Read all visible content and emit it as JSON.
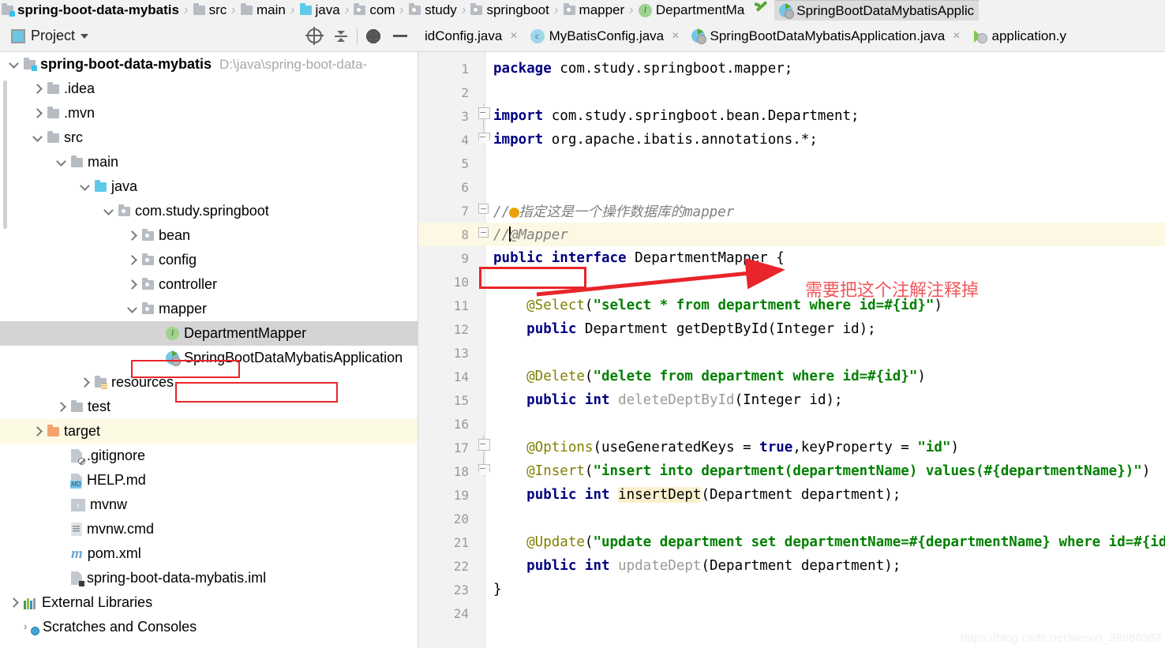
{
  "breadcrumb": {
    "items": [
      {
        "label": "spring-boot-data-mybatis",
        "icon": "module-folder-icon",
        "kind": "module"
      },
      {
        "label": "src",
        "icon": "folder-icon",
        "kind": "folder"
      },
      {
        "label": "main",
        "icon": "folder-icon",
        "kind": "folder"
      },
      {
        "label": "java",
        "icon": "source-folder-icon",
        "kind": "source"
      },
      {
        "label": "com",
        "icon": "package-icon",
        "kind": "package"
      },
      {
        "label": "study",
        "icon": "package-icon",
        "kind": "package"
      },
      {
        "label": "springboot",
        "icon": "package-icon",
        "kind": "package"
      },
      {
        "label": "mapper",
        "icon": "package-icon",
        "kind": "package"
      },
      {
        "label": "DepartmentMa",
        "icon": "interface-icon",
        "kind": "interface"
      }
    ],
    "separator": "›",
    "running_tab": {
      "label": "SpringBootDataMybatisApplic",
      "icon": "spring-boot-run-icon"
    },
    "green_arrow_icon": "green-arrow-icon"
  },
  "toolwindow": {
    "title": "Project",
    "project_icon": "project-icon",
    "dropdown_icon": "chevron-down-icon",
    "actions": [
      {
        "name": "locate-icon",
        "title": "Select Opened File"
      },
      {
        "name": "collapse-all-icon",
        "title": "Collapse All"
      },
      {
        "name": "gear-icon",
        "title": "Settings"
      },
      {
        "name": "minimize-icon",
        "title": "Hide"
      }
    ]
  },
  "editor_tabs": [
    {
      "label": "idConfig.java",
      "icon": "java-class-icon",
      "active": false,
      "closable": true,
      "clipped": true
    },
    {
      "label": "MyBatisConfig.java",
      "icon": "java-class-icon",
      "active": false,
      "closable": true
    },
    {
      "label": "SpringBootDataMybatisApplication.java",
      "icon": "spring-boot-class-icon",
      "active": false,
      "closable": true
    },
    {
      "label": "application.y",
      "icon": "yaml-file-icon",
      "active": false,
      "closable": false,
      "clipped": true
    }
  ],
  "tree": {
    "rows": [
      {
        "indent": 0,
        "twist": "down",
        "icon": "module-folder-icon",
        "label": "spring-boot-data-mybatis",
        "bold": true,
        "path": "D:\\java\\spring-boot-data-"
      },
      {
        "indent": 1,
        "twist": "right",
        "icon": "folder-icon",
        "label": ".idea"
      },
      {
        "indent": 1,
        "twist": "right",
        "icon": "folder-icon",
        "label": ".mvn"
      },
      {
        "indent": 1,
        "twist": "down",
        "icon": "folder-icon",
        "label": "src"
      },
      {
        "indent": 2,
        "twist": "down",
        "icon": "folder-icon",
        "label": "main"
      },
      {
        "indent": 3,
        "twist": "down",
        "icon": "source-folder-icon",
        "label": "java"
      },
      {
        "indent": 4,
        "twist": "down",
        "icon": "package-icon",
        "label": "com.study.springboot"
      },
      {
        "indent": 5,
        "twist": "right",
        "icon": "package-icon",
        "label": "bean"
      },
      {
        "indent": 5,
        "twist": "right",
        "icon": "package-icon",
        "label": "config"
      },
      {
        "indent": 5,
        "twist": "right",
        "icon": "package-icon",
        "label": "controller"
      },
      {
        "indent": 5,
        "twist": "down",
        "icon": "package-icon",
        "label": "mapper",
        "boxed": true
      },
      {
        "indent": 6,
        "twist": "none",
        "icon": "interface-icon",
        "label": "DepartmentMapper",
        "selected": true,
        "boxed": true
      },
      {
        "indent": 6,
        "twist": "none",
        "icon": "spring-boot-class-icon",
        "label": "SpringBootDataMybatisApplication"
      },
      {
        "indent": 3,
        "twist": "right",
        "icon": "resources-folder-icon",
        "label": "resources"
      },
      {
        "indent": 2,
        "twist": "right",
        "icon": "folder-icon",
        "label": "test"
      },
      {
        "indent": 1,
        "twist": "right",
        "icon": "target-folder-icon",
        "label": "target",
        "highlight": true
      },
      {
        "indent": 2,
        "twist": "none",
        "icon": "gitignore-file-icon",
        "label": ".gitignore"
      },
      {
        "indent": 2,
        "twist": "none",
        "icon": "markdown-file-icon",
        "label": "HELP.md"
      },
      {
        "indent": 2,
        "twist": "none",
        "icon": "shell-script-icon",
        "label": "mvnw"
      },
      {
        "indent": 2,
        "twist": "none",
        "icon": "cmd-script-icon",
        "label": "mvnw.cmd"
      },
      {
        "indent": 2,
        "twist": "none",
        "icon": "maven-file-icon",
        "label": "pom.xml"
      },
      {
        "indent": 2,
        "twist": "none",
        "icon": "iml-file-icon",
        "label": "spring-boot-data-mybatis.iml"
      },
      {
        "indent": 0,
        "twist": "right",
        "icon": "external-libraries-icon",
        "label": "External Libraries"
      },
      {
        "indent": 0,
        "twist": "none",
        "icon": "scratches-icon",
        "label": "Scratches and Consoles"
      }
    ]
  },
  "code": {
    "lines": [
      {
        "n": "1",
        "fold": "none",
        "segments": [
          {
            "t": "package ",
            "c": "kw"
          },
          {
            "t": "com.study.springboot.mapper;",
            "c": ""
          }
        ]
      },
      {
        "n": "2",
        "fold": "none",
        "segments": []
      },
      {
        "n": "3",
        "fold": "top",
        "segments": [
          {
            "t": "import ",
            "c": "kw"
          },
          {
            "t": "com.study.springboot.bean.Department;",
            "c": ""
          }
        ]
      },
      {
        "n": "4",
        "fold": "end",
        "segments": [
          {
            "t": "import ",
            "c": "kw"
          },
          {
            "t": "org.apache.ibatis.annotations.*;",
            "c": ""
          }
        ]
      },
      {
        "n": "5",
        "fold": "none",
        "segments": []
      },
      {
        "n": "6",
        "fold": "none",
        "segments": []
      },
      {
        "n": "7",
        "fold": "minus",
        "segments": [
          {
            "t": "//",
            "c": "cmt"
          },
          {
            "t": "",
            "c": "warn-dot"
          },
          {
            "t": "指定这是一个操作数据库的mapper",
            "c": "cmt"
          }
        ]
      },
      {
        "n": "8",
        "fold": "minus",
        "hl": true,
        "boxed": true,
        "segments": [
          {
            "t": "//",
            "c": "cmt"
          },
          {
            "t": "",
            "c": "caret"
          },
          {
            "t": "@Mapper",
            "c": "cmt"
          }
        ]
      },
      {
        "n": "9",
        "fold": "none",
        "segments": [
          {
            "t": "public ",
            "c": "kw"
          },
          {
            "t": "interface ",
            "c": "kw"
          },
          {
            "t": "DepartmentMapper {",
            "c": ""
          }
        ]
      },
      {
        "n": "10",
        "fold": "none",
        "segments": []
      },
      {
        "n": "11",
        "fold": "none",
        "segments": [
          {
            "t": "    @Select",
            "c": "ann"
          },
          {
            "t": "(",
            "c": ""
          },
          {
            "t": "\"select * from department where id=#{id}\"",
            "c": "str"
          },
          {
            "t": ")",
            "c": ""
          }
        ]
      },
      {
        "n": "12",
        "fold": "none",
        "segments": [
          {
            "t": "    ",
            "c": ""
          },
          {
            "t": "public ",
            "c": "kw"
          },
          {
            "t": "Department getDeptById(Integer id);",
            "c": ""
          }
        ]
      },
      {
        "n": "13",
        "fold": "none",
        "segments": []
      },
      {
        "n": "14",
        "fold": "none",
        "segments": [
          {
            "t": "    @Delete",
            "c": "ann"
          },
          {
            "t": "(",
            "c": ""
          },
          {
            "t": "\"delete from department where id=#{id}\"",
            "c": "str"
          },
          {
            "t": ")",
            "c": ""
          }
        ]
      },
      {
        "n": "15",
        "fold": "none",
        "segments": [
          {
            "t": "    ",
            "c": ""
          },
          {
            "t": "public ",
            "c": "kw"
          },
          {
            "t": "int ",
            "c": "kw"
          },
          {
            "t": "deleteDeptById",
            "c": "meth"
          },
          {
            "t": "(Integer id);",
            "c": ""
          }
        ]
      },
      {
        "n": "16",
        "fold": "none",
        "segments": []
      },
      {
        "n": "17",
        "fold": "top",
        "segments": [
          {
            "t": "    @Options",
            "c": "ann"
          },
          {
            "t": "(useGeneratedKeys = ",
            "c": ""
          },
          {
            "t": "true",
            "c": "kw"
          },
          {
            "t": ",keyProperty = ",
            "c": ""
          },
          {
            "t": "\"id\"",
            "c": "str"
          },
          {
            "t": ")",
            "c": ""
          }
        ]
      },
      {
        "n": "18",
        "fold": "end",
        "segments": [
          {
            "t": "    @Insert",
            "c": "ann"
          },
          {
            "t": "(",
            "c": ""
          },
          {
            "t": "\"insert into department(departmentName) values(#{departmentName})\"",
            "c": "str"
          },
          {
            "t": ")",
            "c": ""
          }
        ]
      },
      {
        "n": "19",
        "fold": "none",
        "segments": [
          {
            "t": "    ",
            "c": ""
          },
          {
            "t": "public ",
            "c": "kw"
          },
          {
            "t": "int ",
            "c": "kw"
          },
          {
            "t": "insertDept",
            "c": "hl-yellow-txt"
          },
          {
            "t": "(Department department);",
            "c": ""
          }
        ]
      },
      {
        "n": "20",
        "fold": "none",
        "segments": []
      },
      {
        "n": "21",
        "fold": "none",
        "segments": [
          {
            "t": "    @Update",
            "c": "ann"
          },
          {
            "t": "(",
            "c": ""
          },
          {
            "t": "\"update department set departmentName=#{departmentName} where id=#{id}\"",
            "c": "str"
          },
          {
            "t": ")",
            "c": ""
          }
        ]
      },
      {
        "n": "22",
        "fold": "none",
        "segments": [
          {
            "t": "    ",
            "c": ""
          },
          {
            "t": "public ",
            "c": "kw"
          },
          {
            "t": "int ",
            "c": "kw"
          },
          {
            "t": "updateDept",
            "c": "meth"
          },
          {
            "t": "(Department department);",
            "c": ""
          }
        ]
      },
      {
        "n": "23",
        "fold": "none",
        "segments": [
          {
            "t": "}",
            "c": ""
          }
        ]
      },
      {
        "n": "24",
        "fold": "none",
        "segments": []
      }
    ]
  },
  "annotations": {
    "note_text": "需要把这个注解注释掉",
    "note_color": "#f0565a",
    "box_color": "#e8252a",
    "arrow_color": "#e8252a"
  },
  "watermark": "https://blog.csdn.net/weixin_39868387"
}
